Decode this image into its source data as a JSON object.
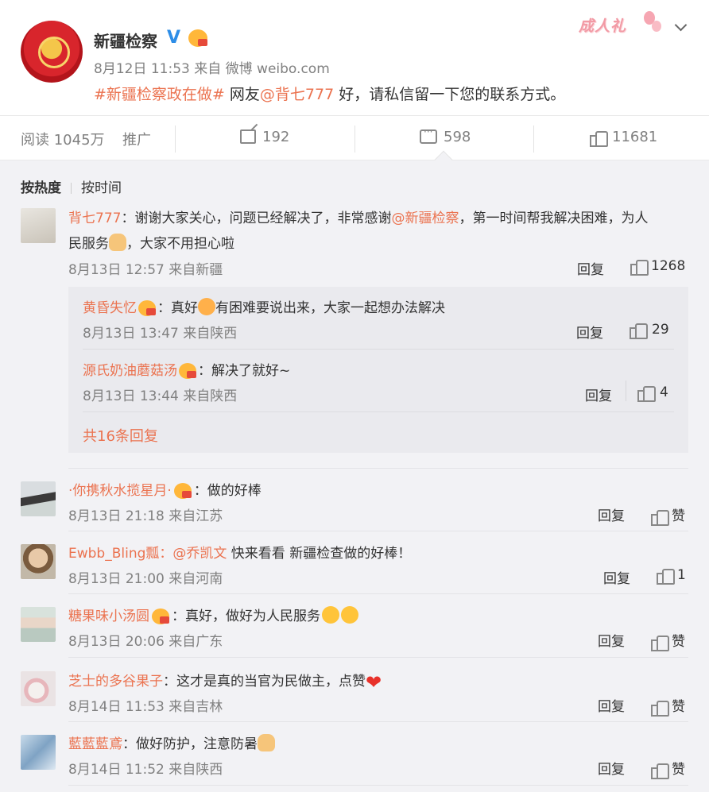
{
  "post": {
    "author": "新疆检察",
    "verified_icon": "V",
    "time": "8月12日 11:53",
    "source": "来自 微博 weibo.com",
    "hashtag": "#新疆检察政在做#",
    "text_prefix": "网友",
    "mention": "@背七777",
    "text_suffix": "好，请私信留一下您的联系方式。",
    "ceremony_label": "成人礼"
  },
  "actions": {
    "reads": "阅读 1045万",
    "promote": "推广",
    "shares": "192",
    "comments": "598",
    "likes": "11681"
  },
  "sort": {
    "hot": "按热度",
    "time": "按时间"
  },
  "comments": [
    {
      "user": "背七777",
      "text_a": "：谢谢大家关心，问题已经解决了，非常感谢",
      "mention": "@新疆检察",
      "text_b": "，第一时间帮我解决困难，为人",
      "text_c": "民服务",
      "text_d": "，大家不用担心啦",
      "time": "8月13日 12:57 来自新疆",
      "reply": "回复",
      "likes": "1268",
      "replies": [
        {
          "user": "黄昏失忆",
          "text_a": "：真好",
          "text_b": "有困难要说出来，大家一起想办法解决",
          "time": "8月13日 13:47 来自陕西",
          "reply": "回复",
          "likes": "29"
        },
        {
          "user": "源氏奶油蘑菇汤",
          "text_a": "：解决了就好~",
          "time": "8月13日 13:44 来自陕西",
          "reply": "回复",
          "likes": "4"
        }
      ],
      "more": "共16条回复"
    },
    {
      "user": "·你携秋水揽星月·",
      "text": "：做的好棒",
      "time": "8月13日 21:18 来自江苏",
      "reply": "回复",
      "likes": "赞"
    },
    {
      "user": "Ewbb_Bling瓢",
      "mention": "：@乔凯文",
      "text": " 快来看看 新疆检查做的好棒！",
      "time": "8月13日 21:00 来自河南",
      "reply": "回复",
      "likes": "1"
    },
    {
      "user": "糖果味小汤圆",
      "text": "：真好，做好为人民服务",
      "time": "8月13日 20:06 来自广东",
      "reply": "回复",
      "likes": "赞"
    },
    {
      "user": "芝士的多谷果子",
      "text": "：这才是真的当官为民做主，点赞",
      "time": "8月14日 11:53 来自吉林",
      "reply": "回复",
      "likes": "赞"
    },
    {
      "user": "藍藍藍鳶",
      "text": "：做好防护，注意防暑",
      "time": "8月14日 11:52 来自陕西",
      "reply": "回复",
      "likes": "赞"
    }
  ],
  "colors": {
    "accent": "#eb7350",
    "muted": "#808080",
    "panel": "#f2f2f5"
  }
}
